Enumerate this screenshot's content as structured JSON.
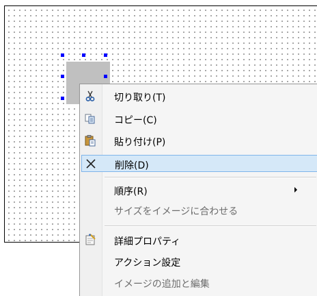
{
  "context_menu": {
    "items": [
      {
        "label": "切り取り(T)",
        "icon": "scissors-icon",
        "enabled": true
      },
      {
        "label": "コピー(C)",
        "icon": "copy-icon",
        "enabled": true
      },
      {
        "label": "貼り付け(P)",
        "icon": "paste-icon",
        "enabled": true
      },
      {
        "label": "削除(D)",
        "icon": "delete-x-icon",
        "enabled": true,
        "highlighted": true
      },
      {
        "label": "順序(R)",
        "icon": null,
        "enabled": true,
        "has_submenu": true
      },
      {
        "label": "サイズをイメージに合わせる",
        "icon": null,
        "enabled": false
      },
      {
        "label": "詳細プロパティ",
        "icon": "properties-icon",
        "enabled": true
      },
      {
        "label": "アクション設定",
        "icon": null,
        "enabled": true
      },
      {
        "label": "イメージの追加と編集",
        "icon": null,
        "enabled": false
      }
    ]
  },
  "colors": {
    "selection_handle": "#0000ff",
    "shape_fill": "#c0c0c0",
    "highlight_bg": "#d5e8f8",
    "highlight_border": "#7eb4ea",
    "disabled_text": "#6d6d6d"
  }
}
